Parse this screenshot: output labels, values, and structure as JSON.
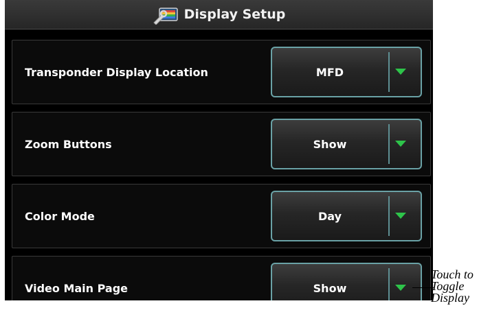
{
  "header": {
    "title": "Display Setup",
    "icon": "wrench-screen-icon"
  },
  "settings": [
    {
      "label": "Transponder Display Location",
      "value": "MFD"
    },
    {
      "label": "Zoom Buttons",
      "value": "Show"
    },
    {
      "label": "Color Mode",
      "value": "Day"
    },
    {
      "label": "Video Main Page",
      "value": "Show"
    }
  ],
  "callout": {
    "text": "Touch to\nToggle\nDisplay"
  },
  "colors": {
    "background": "#000000",
    "button_border": "#6aa2a6",
    "arrow": "#2ec44a",
    "text": "#ffffff"
  }
}
